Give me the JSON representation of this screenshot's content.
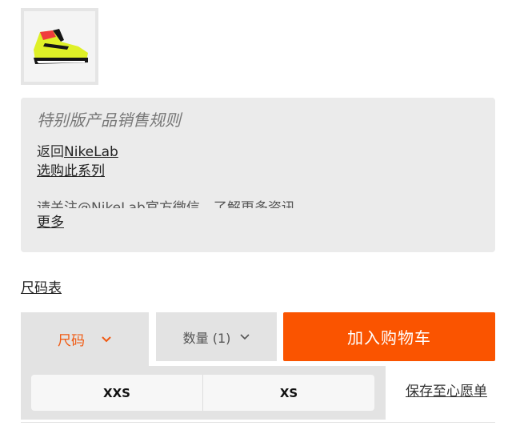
{
  "product": {
    "thumbnail_icon": "sneaker-icon",
    "colors": {
      "neon": "#dff027",
      "red": "#f03c3c",
      "black": "#151515"
    }
  },
  "rules": {
    "title": "特别版产品销售规则",
    "back_prefix": "返回",
    "back_link": "NikeLab",
    "shop_series": "选购此系列",
    "follow_text": "请关注@NikeLab官方微信，了解更多资讯",
    "more": "更多"
  },
  "size_chart": "尺码表",
  "size_selector": {
    "label": "尺码",
    "icon": "chevron-down-icon"
  },
  "quantity": {
    "label": "数量 (1)",
    "icon": "chevron-down-icon"
  },
  "add_to_cart": "加入购物车",
  "sizes": [
    "XXS",
    "XS"
  ],
  "save_wishlist": "保存至心愿单",
  "colors": {
    "accent": "#fa5400",
    "panel": "#ebebeb",
    "control": "#e3e3e3"
  }
}
